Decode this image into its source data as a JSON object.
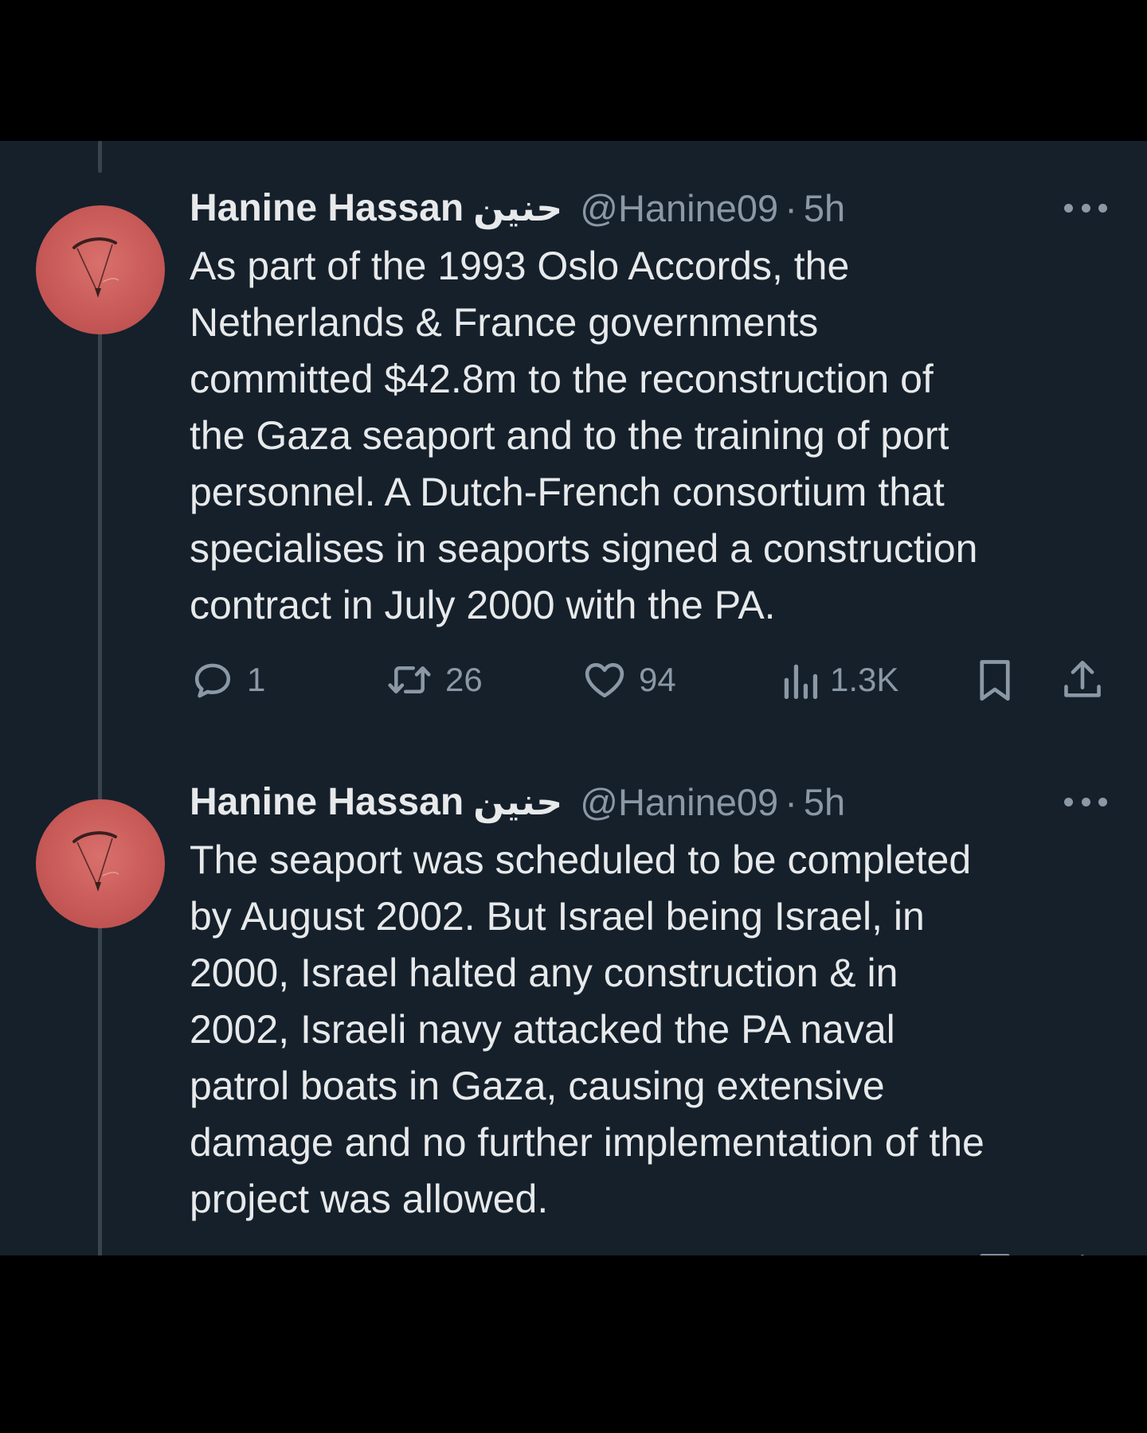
{
  "tweets": [
    {
      "author": {
        "name": "Hanine Hassan",
        "name_arabic": "حنين",
        "handle": "@Hanine09",
        "separator": "·",
        "time": "5h"
      },
      "text_lines": [
        "As part of the 1993 Oslo Accords, the",
        "Netherlands & France governments",
        "committed $42.8m to the reconstruction of",
        "the Gaza seaport and to the training of port",
        "personnel. A Dutch-French consortium that",
        "specialises in seaports signed a construction",
        "contract in July 2000 with the PA."
      ],
      "actions": {
        "replies": "1",
        "retweets": "26",
        "likes": "94",
        "views": "1.3K"
      }
    },
    {
      "author": {
        "name": "Hanine Hassan",
        "name_arabic": "حنين",
        "handle": "@Hanine09",
        "separator": "·",
        "time": "5h"
      },
      "text_lines": [
        "The seaport was scheduled to be completed",
        "by August 2002. But Israel being Israel, in",
        "2000, Israel halted any construction & in",
        "2002, Israeli navy attacked the PA naval",
        "patrol boats in Gaza, causing extensive",
        "damage and no further implementation of the",
        "project was allowed."
      ]
    }
  ],
  "icons": {
    "more": "more-horizontal-icon",
    "reply": "reply-bubble-icon",
    "retweet": "retweet-icon",
    "like": "heart-icon",
    "views": "views-bar-chart-icon",
    "bookmark": "bookmark-icon",
    "share": "share-upload-icon"
  },
  "colors": {
    "background": "#15202b",
    "text_primary": "#e7e9ea",
    "text_secondary": "#8b98a5",
    "thread_line": "#38444d",
    "avatar": "#c85a58"
  }
}
